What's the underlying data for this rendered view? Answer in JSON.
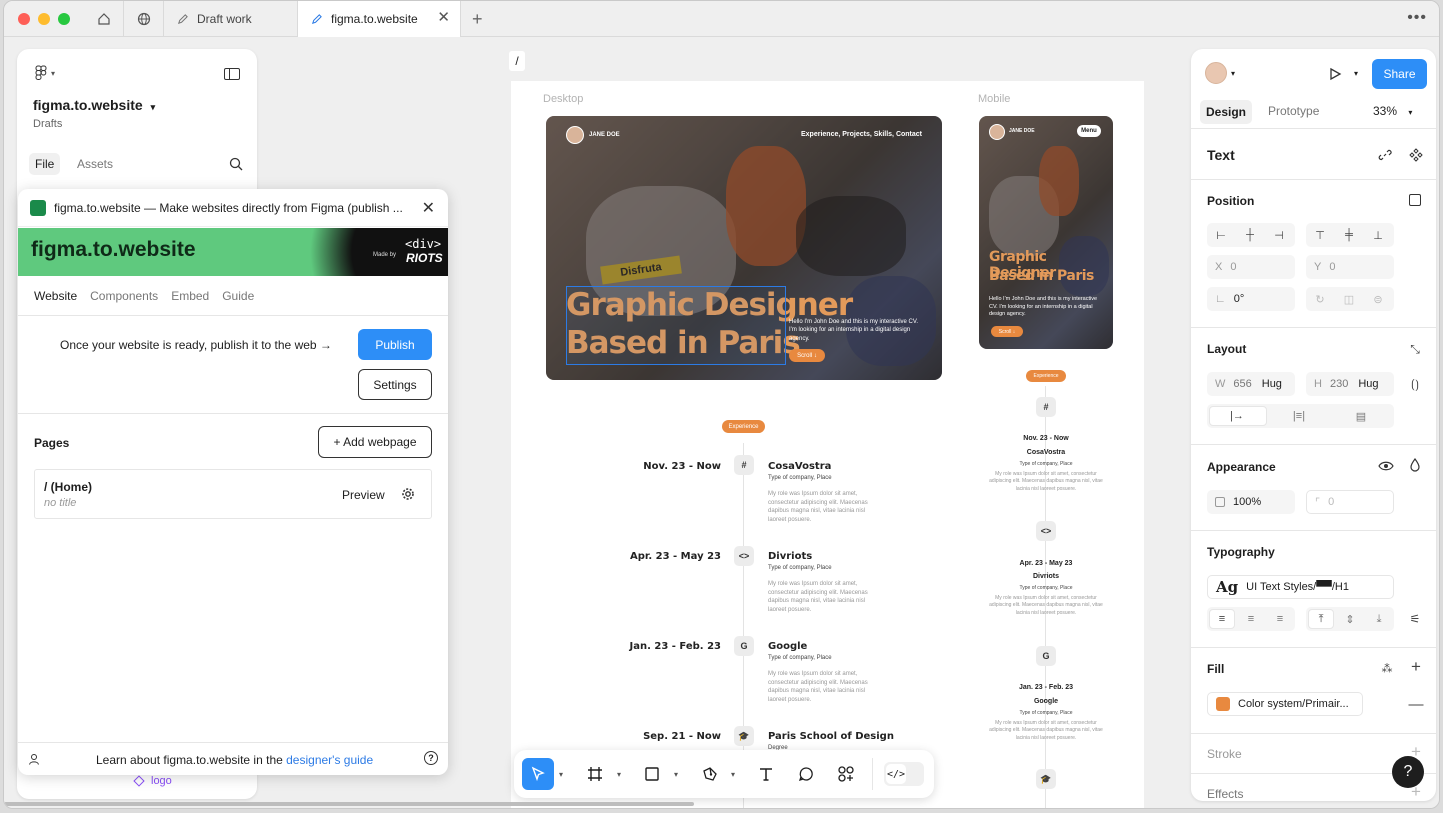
{
  "tabs": [
    {
      "label": "Draft work"
    },
    {
      "label": "figma.to.website"
    }
  ],
  "file": {
    "name": "figma.to.website",
    "location": "Drafts"
  },
  "left_tabs": {
    "file": "File",
    "assets": "Assets"
  },
  "layer_item": "logo",
  "canvas": {
    "breadcrumb": "/",
    "frame_desktop": "Desktop",
    "frame_mobile": "Mobile"
  },
  "hero": {
    "logo_name": "JANE DOE",
    "nav": "Experience, Projects, Skills, Contact",
    "headline_1": "Graphic Designer",
    "headline_2": "Based in Paris",
    "intro": "Hello I'm John Doe and this is my interactive CV. I'm looking for an internship in a digital design agency.",
    "scroll": "Scroll ↓",
    "menu": "Menu",
    "sign_text": "Disfruta"
  },
  "experience_badge": "Experience",
  "timeline": [
    {
      "date": "Nov. 23 - Now",
      "icon": "#",
      "company": "CosaVostra",
      "type": "Type of company, Place",
      "desc": "My role was Ipsum dolor sit amet, consectetur adipiscing elit. Maecenas dapibus magna nisl, vitae lacinia nisl laoreet posuere."
    },
    {
      "date": "Apr. 23 - May 23",
      "icon": "<>",
      "company": "Divriots",
      "type": "Type of company, Place",
      "desc": "My role was Ipsum dolor sit amet, consectetur adipiscing elit. Maecenas dapibus magna nisl, vitae lacinia nisl laoreet posuere."
    },
    {
      "date": "Jan. 23 - Feb. 23",
      "icon": "G",
      "company": "Google",
      "type": "Type of company, Place",
      "desc": "My role was Ipsum dolor sit amet, consectetur adipiscing elit. Maecenas dapibus magna nisl, vitae lacinia nisl laoreet posuere."
    },
    {
      "date": "Sep. 21 - Now",
      "icon": "🎓",
      "company": "Paris School of Design",
      "type": "Degree",
      "desc": ""
    }
  ],
  "plugin": {
    "title": "figma.to.website —  Make websites directly from Figma (publish ...",
    "banner_title": "figma.to.website",
    "banner_made_by": "Made by",
    "banner_brand_top": "<div>",
    "banner_brand_bottom": "RIOTS",
    "tabs": [
      "Website",
      "Components",
      "Embed",
      "Guide"
    ],
    "publish_text": "Once your website is ready, publish it to the web →",
    "publish_button": "Publish",
    "settings_button": "Settings",
    "pages_title": "Pages",
    "add_webpage": "+ Add webpage",
    "page_name": "/ (Home)",
    "page_subtitle": "no title",
    "preview": "Preview",
    "footer_text": "Learn about figma.to.website in the ",
    "footer_link": "designer's guide"
  },
  "right": {
    "share": "Share",
    "tab_design": "Design",
    "tab_prototype": "Prototype",
    "zoom": "33%",
    "selection_type": "Text",
    "position_title": "Position",
    "x_label": "X",
    "x_value": "0",
    "y_label": "Y",
    "y_value": "0",
    "rotation": "0°",
    "layout_title": "Layout",
    "w_label": "W",
    "w_value": "656",
    "w_mode": "Hug",
    "h_label": "H",
    "h_value": "230",
    "h_mode": "Hug",
    "appearance_title": "Appearance",
    "opacity": "100%",
    "radius": "0",
    "typography_title": "Typography",
    "text_style": "UI Text Styles/▀▀/H1",
    "fill_title": "Fill",
    "fill_value": "Color system/Primair...",
    "fill_color": "#e8893f",
    "stroke_title": "Stroke",
    "effects_title": "Effects",
    "help": "?"
  }
}
